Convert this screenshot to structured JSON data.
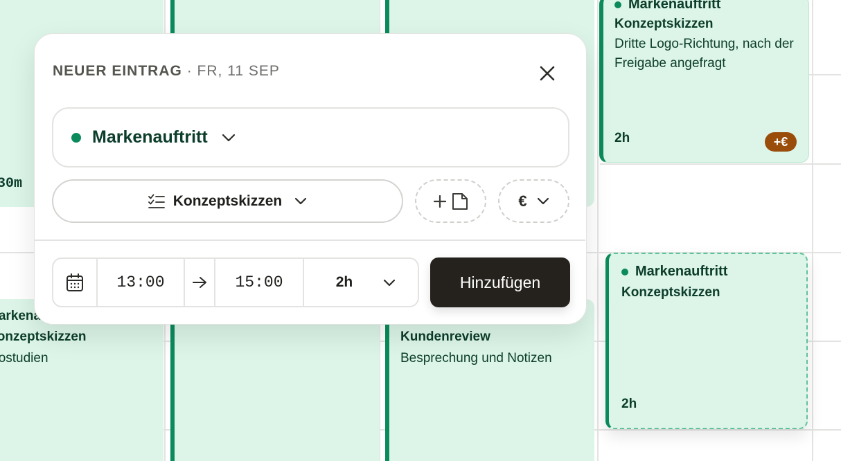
{
  "calendar": {
    "left_event_top": {
      "duration": "30m"
    },
    "left_event_bottom": {
      "project": "Markenauftritt",
      "task": "Konzeptskizzen",
      "desc": "Logostudien"
    },
    "right_event_top": {
      "project": "Markenauftritt",
      "task": "Konzeptskizzen",
      "desc": "Dritte Logo-Richtung, nach der Freigabe angefragt",
      "duration": "2h",
      "badge": "+€"
    },
    "mid_event_bottom": {
      "task": "Kundenreview",
      "desc": "Besprechung und Notizen"
    },
    "draft_event": {
      "project": "Markenauftritt",
      "task": "Konzeptskizzen",
      "duration": "2h"
    }
  },
  "modal": {
    "title": "NEUER EINTRAG",
    "date": "· FR, 11 SEP",
    "project": {
      "label": "Markenauftritt",
      "color": "#0b8b5c"
    },
    "task": {
      "label": "Konzeptskizzen"
    },
    "billing": {
      "symbol": "€"
    },
    "time": {
      "start": "13:00",
      "end": "15:00",
      "duration": "2h"
    },
    "submit_label": "Hinzufügen"
  },
  "colors": {
    "event_bg": "#dcf5e8",
    "event_accent": "#0b8b5c",
    "button_dark": "#25221d",
    "badge": "#9a4c0a"
  }
}
